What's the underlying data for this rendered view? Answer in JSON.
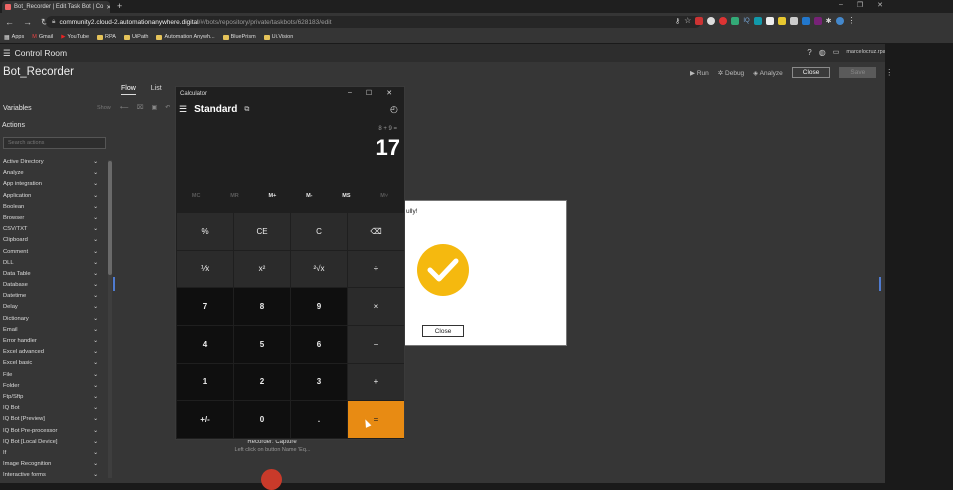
{
  "browser": {
    "tab_title": "Bot_Recorder | Edit Task Bot | Co",
    "url_host": "community2.cloud-2.automationanywhere.digital",
    "url_path": "/#/bots/repository/private/taskbots/628183/edit",
    "bookmarks": [
      "Apps",
      "Gmail",
      "YouTube",
      "RPA",
      "UiPath",
      "Automation Anywh...",
      "BluePrism",
      "Ui.Vision"
    ]
  },
  "app": {
    "header_title": "Control Room",
    "user_email": "marcelocruz.rpa@gmail.com",
    "bot_title": "Bot_Recorder",
    "tabs": [
      "Flow",
      "List"
    ],
    "run_label": "Run",
    "debug_label": "Debug",
    "analyze_label": "Analyze",
    "close_label": "Close",
    "save_label": "Save",
    "variables_label": "Variables",
    "show_label": "Show",
    "actions_label": "Actions",
    "search_placeholder": "Search actions",
    "actions": [
      "Active Directory",
      "Analyze",
      "App integration",
      "Application",
      "Boolean",
      "Browser",
      "CSV/TXT",
      "Clipboard",
      "Comment",
      "DLL",
      "Data Table",
      "Database",
      "Datetime",
      "Delay",
      "Dictionary",
      "Email",
      "Error handler",
      "Excel advanced",
      "Excel basic",
      "File",
      "Folder",
      "Ftp/Sftp",
      "IQ Bot",
      "IQ Bot [Preview]",
      "IQ Bot Pre-processor",
      "IQ Bot [Local Device]",
      "If",
      "Image Recognition",
      "Interactive forms"
    ],
    "recorder_title": "Recorder: Capture",
    "recorder_sub": "Left click on button Name 'Eq..."
  },
  "dialog": {
    "text": "ully!",
    "close_label": "Close"
  },
  "calculator": {
    "window_title": "Calculator",
    "mode": "Standard",
    "expression": "8 + 9 =",
    "result": "17",
    "memory": [
      "MC",
      "MR",
      "M+",
      "M-",
      "MS",
      "M˅"
    ],
    "keys": [
      "%",
      "CE",
      "C",
      "⌫",
      "⅟x",
      "x²",
      "²√x",
      "÷",
      "7",
      "8",
      "9",
      "×",
      "4",
      "5",
      "6",
      "−",
      "1",
      "2",
      "3",
      "+",
      "+/-",
      "0",
      ".",
      "="
    ]
  },
  "colors": {
    "accent": "#e88b13",
    "success": "#f5b90f",
    "brand_bell": "#f0a800"
  }
}
